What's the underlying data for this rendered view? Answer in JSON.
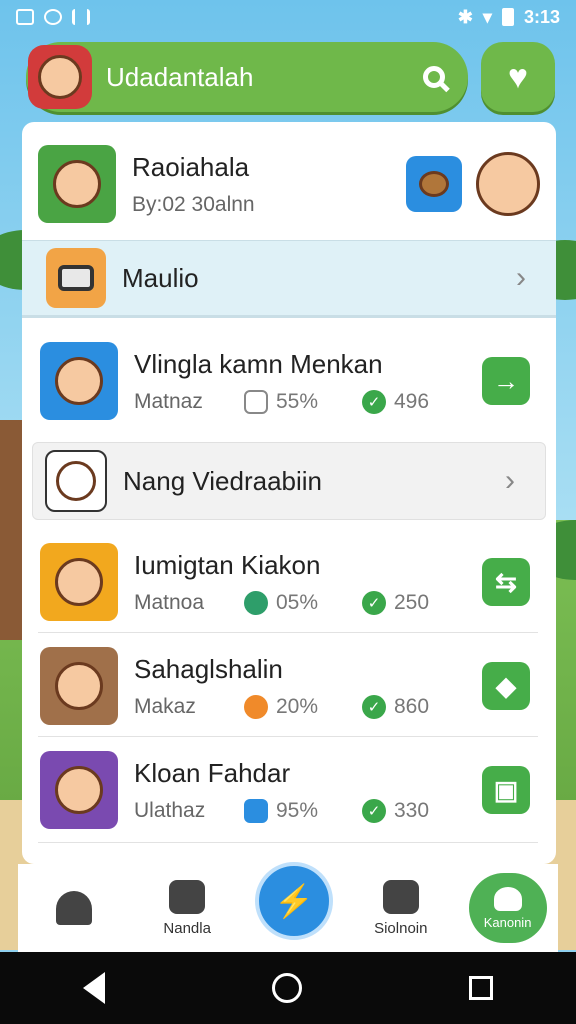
{
  "status_bar": {
    "time": "3:13"
  },
  "header": {
    "title": "Udadantalah"
  },
  "list": {
    "featured": {
      "name": "Raoiahala",
      "sub": "By:02 30alnn"
    },
    "highlight": {
      "name": "Maulio"
    },
    "items": [
      {
        "name": "Vlingla kamn Menkan",
        "meta": "Matnaz",
        "stat1": "55%",
        "stat2": "496",
        "action": "→"
      },
      {
        "name": "Nang Viedraabiin",
        "action": "›"
      },
      {
        "name": "Iumigtan Kiakon",
        "meta": "Matnoa",
        "stat1": "05%",
        "stat2": "250",
        "action": "⇆"
      },
      {
        "name": "Sahaglshalin",
        "meta": "Makaz",
        "stat1": "20%",
        "stat2": "860",
        "action": "◆"
      },
      {
        "name": "Kloan Fahdar",
        "meta": "Ulathaz",
        "stat1": "95%",
        "stat2": "330",
        "action": "▣"
      }
    ]
  },
  "nav": {
    "item2_label": "Nandla",
    "item4_label": "Siolnoin",
    "item5_label": "Kanonin"
  },
  "colors": {
    "accent_green": "#6fb84a",
    "action_green": "#46ad49",
    "center_blue": "#2b8ee0"
  }
}
